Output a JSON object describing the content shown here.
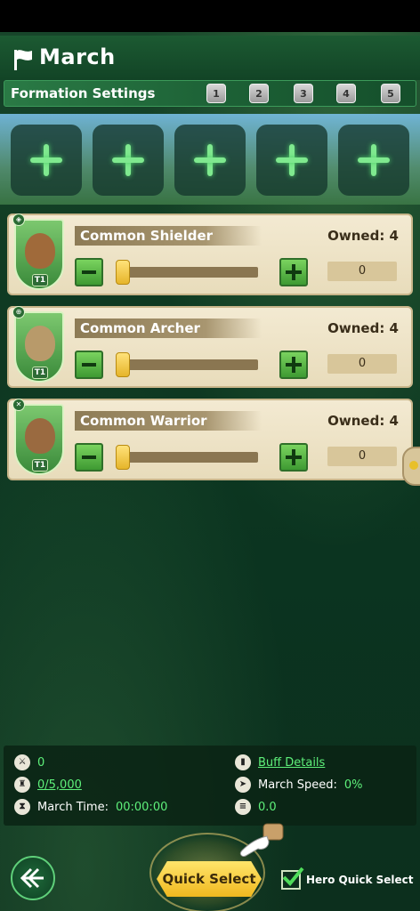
{
  "header": {
    "title": "March"
  },
  "formation": {
    "label": "Formation Settings",
    "slots": [
      "1",
      "2",
      "3",
      "4",
      "5"
    ]
  },
  "hero_slots": [
    "add",
    "add",
    "add",
    "add",
    "add"
  ],
  "units": [
    {
      "name": "Common Shielder",
      "owned": "Owned: 4",
      "quantity": "0",
      "tier": "T1",
      "type_icon": "shield-icon",
      "color": "#a06a3a"
    },
    {
      "name": "Common Archer",
      "owned": "Owned: 4",
      "quantity": "0",
      "tier": "T1",
      "type_icon": "bow-icon",
      "color": "#b89a6a"
    },
    {
      "name": "Common Warrior",
      "owned": "Owned: 4",
      "quantity": "0",
      "tier": "T1",
      "type_icon": "swords-icon",
      "color": "#9a6a40"
    }
  ],
  "info": {
    "power": "0",
    "troop_count": "0/5,000",
    "march_time_label": "March Time:",
    "march_time_value": "00:00:00",
    "buff_details": "Buff Details",
    "march_speed_label": "March Speed:",
    "march_speed_value": "0%",
    "load": "0.0"
  },
  "footer": {
    "quick_select": "Quick Select",
    "hero_quick_select": "Hero Quick Select",
    "hero_quick_select_checked": true
  },
  "colors": {
    "accent_green": "#5ef07a",
    "button_gold": "#f0b81f",
    "card_bg": "#f3ead2"
  }
}
